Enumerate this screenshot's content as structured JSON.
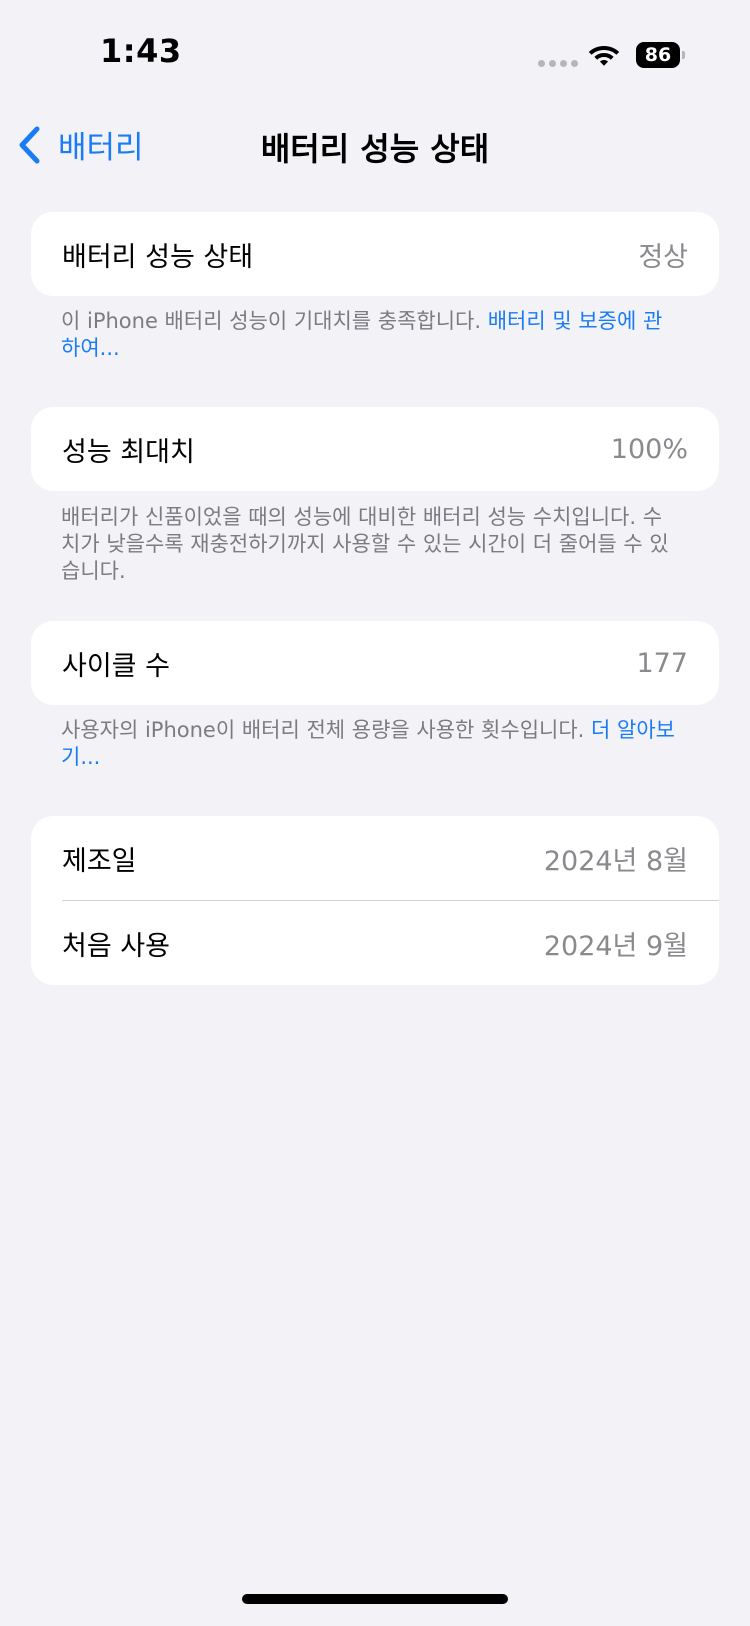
{
  "status_bar": {
    "time": "1:43",
    "battery_level": "86"
  },
  "nav": {
    "back_label": "배터리",
    "title": "배터리 성능 상태"
  },
  "battery_health": {
    "label": "배터리 성능 상태",
    "value": "정상",
    "footnote_text": "이 iPhone 배터리 성능이 기대치를 충족합니다. ",
    "footnote_link": "배터리 및 보증에 관하여..."
  },
  "max_capacity": {
    "label": "성능 최대치",
    "value": "100%",
    "footnote_text": "배터리가 신품이었을 때의 성능에 대비한 배터리 성능 수치입니다. 수치가 낮을수록 재충전하기까지 사용할 수 있는 시간이 더 줄어들 수 있습니다."
  },
  "cycle_count": {
    "label": "사이클 수",
    "value": "177",
    "footnote_text": "사용자의 iPhone이 배터리 전체 용량을 사용한 횟수입니다. ",
    "footnote_link": "더 알아보기..."
  },
  "dates": {
    "manufacture_label": "제조일",
    "manufacture_value": "2024년 8월",
    "first_use_label": "처음 사용",
    "first_use_value": "2024년 9월"
  },
  "colors": {
    "accent": "#1a7cf5",
    "background": "#f2f2f7",
    "secondary_text": "#8a8a8e"
  }
}
